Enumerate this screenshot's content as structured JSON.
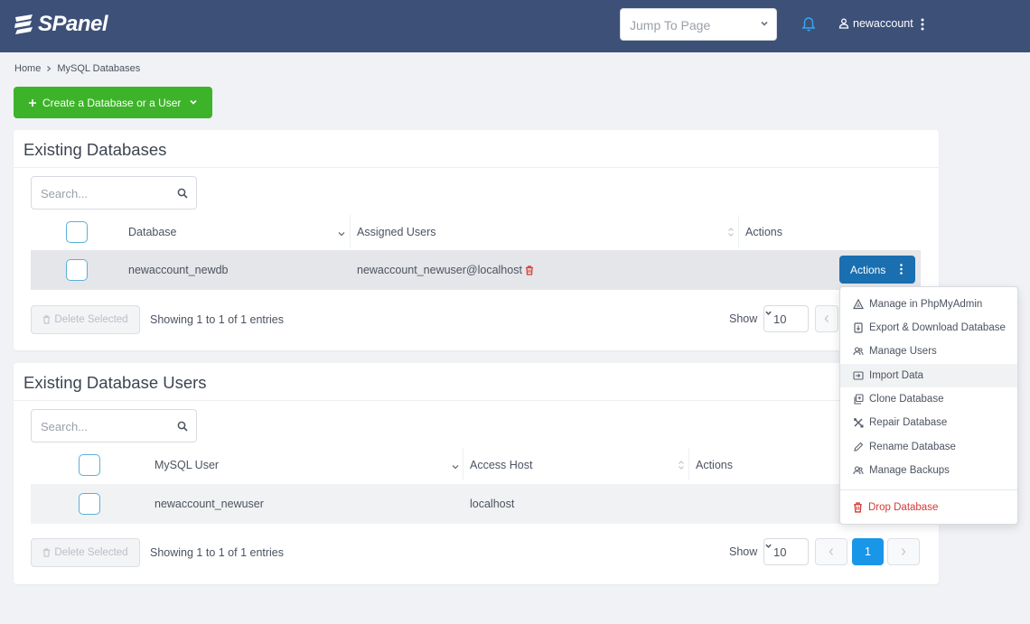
{
  "app": {
    "logo_text": "SPanel"
  },
  "header": {
    "jump_placeholder": "Jump To Page",
    "username": "newaccount"
  },
  "breadcrumb": {
    "home": "Home",
    "current": "MySQL Databases"
  },
  "create_button": {
    "label": "Create a Database or a User"
  },
  "databases": {
    "title": "Existing Databases",
    "search_placeholder": "Search...",
    "columns": {
      "database": "Database",
      "users": "Assigned Users",
      "actions": "Actions"
    },
    "rows": [
      {
        "database": "newaccount_newdb",
        "user": "newaccount_newuser@localhost",
        "action_label": "Actions"
      }
    ],
    "delete_label": "Delete Selected",
    "showing": "Showing 1 to 1 of 1 entries",
    "show_label": "Show",
    "page_size": "10"
  },
  "users": {
    "title": "Existing Database Users",
    "search_placeholder": "Search...",
    "columns": {
      "user": "MySQL User",
      "host": "Access Host",
      "actions": "Actions"
    },
    "rows": [
      {
        "user": "newaccount_newuser",
        "host": "localhost"
      }
    ],
    "delete_label": "Delete Selected",
    "showing": "Showing 1 to 1 of 1 entries",
    "show_label": "Show",
    "page_size": "10",
    "page": "1"
  },
  "actions_menu": {
    "items": [
      {
        "label": "Manage in PhpMyAdmin",
        "icon": "phpmyadmin-icon"
      },
      {
        "label": "Export & Download Database",
        "icon": "export-icon"
      },
      {
        "label": "Manage Users",
        "icon": "users-icon"
      },
      {
        "label": "Import Data",
        "icon": "import-icon"
      },
      {
        "label": "Clone Database",
        "icon": "clone-icon"
      },
      {
        "label": "Repair Database",
        "icon": "tools-icon"
      },
      {
        "label": "Rename Database",
        "icon": "pencil-icon"
      },
      {
        "label": "Manage Backups",
        "icon": "backups-icon"
      }
    ],
    "danger_item": {
      "label": "Drop Database",
      "icon": "trash-icon"
    }
  },
  "colors": {
    "header_bg": "#3c5078",
    "create_green": "#3db32a",
    "actions_blue": "#1a6fb0",
    "page_active": "#1a96e8",
    "danger": "#d33b35"
  }
}
